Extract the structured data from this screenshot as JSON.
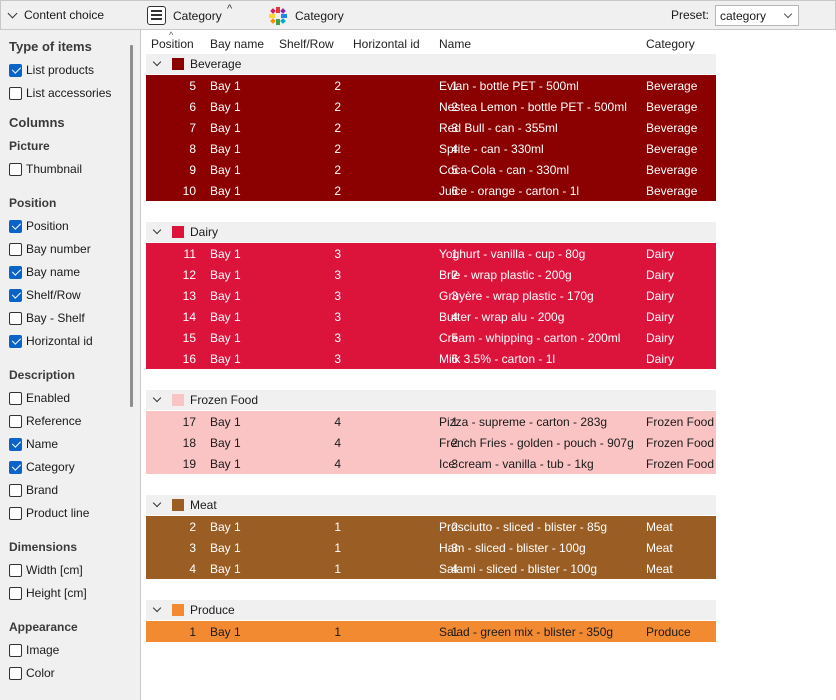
{
  "toolbar": {
    "panel_title": "Content choice",
    "group_by_label": "Category",
    "sort_indicator": "^",
    "color_by_label": "Category",
    "preset_label": "Preset:",
    "preset_value": "category"
  },
  "sidebar": {
    "type_heading": "Type of items",
    "type_items": [
      {
        "label": "List products",
        "checked": true
      },
      {
        "label": "List accessories",
        "checked": false
      }
    ],
    "columns_heading": "Columns",
    "picture_heading": "Picture",
    "picture_items": [
      {
        "label": "Thumbnail",
        "checked": false
      }
    ],
    "position_heading": "Position",
    "position_items": [
      {
        "label": "Position",
        "checked": true
      },
      {
        "label": "Bay number",
        "checked": false
      },
      {
        "label": "Bay name",
        "checked": true
      },
      {
        "label": "Shelf/Row",
        "checked": true
      },
      {
        "label": "Bay - Shelf",
        "checked": false
      },
      {
        "label": "Horizontal id",
        "checked": true
      }
    ],
    "description_heading": "Description",
    "description_items": [
      {
        "label": "Enabled",
        "checked": false
      },
      {
        "label": "Reference",
        "checked": false
      },
      {
        "label": "Name",
        "checked": true
      },
      {
        "label": "Category",
        "checked": true
      },
      {
        "label": "Brand",
        "checked": false
      },
      {
        "label": "Product line",
        "checked": false
      }
    ],
    "dimensions_heading": "Dimensions",
    "dimensions_items": [
      {
        "label": "Width [cm]",
        "checked": false
      },
      {
        "label": "Height [cm]",
        "checked": false
      }
    ],
    "appearance_heading": "Appearance",
    "appearance_items": [
      {
        "label": "Image",
        "checked": false
      },
      {
        "label": "Color",
        "checked": false
      }
    ]
  },
  "table": {
    "sort_indicator": "^",
    "columns": [
      "Position",
      "Bay name",
      "Shelf/Row",
      "Horizontal id",
      "Name",
      "Category"
    ],
    "groups": [
      {
        "name": "Beverage",
        "color": "#8b0000",
        "text_color": "#ffffff",
        "rows": [
          [
            "5",
            "Bay 1",
            "2",
            "1",
            "Evian - bottle PET - 500ml",
            "Beverage"
          ],
          [
            "6",
            "Bay 1",
            "2",
            "2",
            "Nestea Lemon - bottle PET - 500ml",
            "Beverage"
          ],
          [
            "7",
            "Bay 1",
            "2",
            "3",
            "Red Bull - can - 355ml",
            "Beverage"
          ],
          [
            "8",
            "Bay 1",
            "2",
            "4",
            "Sprite - can - 330ml",
            "Beverage"
          ],
          [
            "9",
            "Bay 1",
            "2",
            "5",
            "Coca-Cola - can - 330ml",
            "Beverage"
          ],
          [
            "10",
            "Bay 1",
            "2",
            "6",
            "Juice - orange - carton - 1l",
            "Beverage"
          ]
        ]
      },
      {
        "name": "Dairy",
        "color": "#dc143c",
        "text_color": "#ffffff",
        "rows": [
          [
            "11",
            "Bay 1",
            "3",
            "1",
            "Yoghurt - vanilla - cup - 80g",
            "Dairy"
          ],
          [
            "12",
            "Bay 1",
            "3",
            "2",
            "Brie - wrap plastic - 200g",
            "Dairy"
          ],
          [
            "13",
            "Bay 1",
            "3",
            "3",
            "Gruyère - wrap plastic - 170g",
            "Dairy"
          ],
          [
            "14",
            "Bay 1",
            "3",
            "4",
            "Butter - wrap alu - 200g",
            "Dairy"
          ],
          [
            "15",
            "Bay 1",
            "3",
            "5",
            "Cream - whipping - carton - 200ml",
            "Dairy"
          ],
          [
            "16",
            "Bay 1",
            "3",
            "6",
            "Milk 3.5% - carton - 1l",
            "Dairy"
          ]
        ]
      },
      {
        "name": "Frozen Food",
        "color": "#fbc4c4",
        "text_color": "#1a1a1a",
        "rows": [
          [
            "17",
            "Bay 1",
            "4",
            "1",
            "Pizza - supreme - carton - 283g",
            "Frozen Food"
          ],
          [
            "18",
            "Bay 1",
            "4",
            "2",
            "French Fries - golden - pouch - 907g",
            "Frozen Food"
          ],
          [
            "19",
            "Bay 1",
            "4",
            "3",
            "Ice cream - vanilla - tub - 1kg",
            "Frozen Food"
          ]
        ]
      },
      {
        "name": "Meat",
        "color": "#9a5e25",
        "text_color": "#ffffff",
        "rows": [
          [
            "2",
            "Bay 1",
            "1",
            "2",
            "Prosciutto - sliced - blister - 85g",
            "Meat"
          ],
          [
            "3",
            "Bay 1",
            "1",
            "3",
            "Ham - sliced - blister - 100g",
            "Meat"
          ],
          [
            "4",
            "Bay 1",
            "1",
            "4",
            "Salami - sliced - blister - 100g",
            "Meat"
          ]
        ]
      },
      {
        "name": "Produce",
        "color": "#f28a32",
        "text_color": "#1a1a1a",
        "rows": [
          [
            "1",
            "Bay 1",
            "1",
            "1",
            "Salad - green mix - blister - 350g",
            "Produce"
          ]
        ]
      }
    ]
  }
}
